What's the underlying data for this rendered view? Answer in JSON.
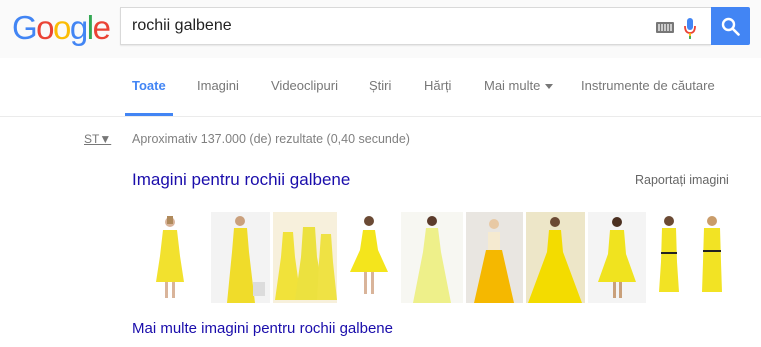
{
  "logo": {
    "letters": [
      "G",
      "o",
      "o",
      "g",
      "l",
      "e"
    ],
    "colors": [
      "#4285f4",
      "#ea4335",
      "#fbbc05",
      "#4285f4",
      "#34a853",
      "#ea4335"
    ]
  },
  "search": {
    "query": "rochii galbene"
  },
  "tabs": [
    "Toate",
    "Imagini",
    "Videoclipuri",
    "Știri",
    "Hărți",
    "Mai multe",
    "Instrumente de căutare"
  ],
  "st_toggle": "ST▼",
  "result_stats": "Aproximativ 137.000 (de) rezultate (0,40 secunde)",
  "images_section": {
    "title": "Imagini pentru rochii galbene",
    "report": "Raportați imagini",
    "more": "Mai multe imagini pentru rochii galbene"
  },
  "colors": {
    "accent": "#4285f4",
    "link": "#1a0dab",
    "dress": "#f2e12e",
    "dress_dark": "#e2c800"
  }
}
